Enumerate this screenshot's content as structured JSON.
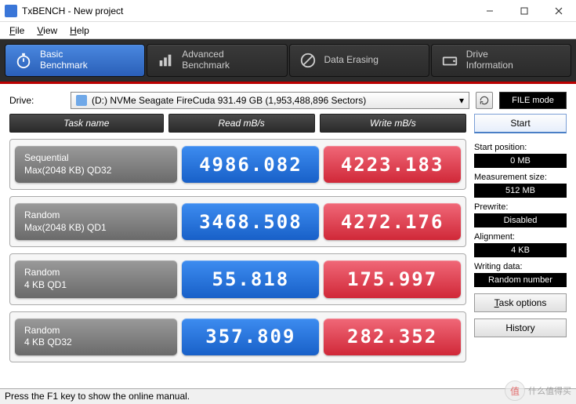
{
  "window": {
    "title": "TxBENCH - New project"
  },
  "menu": {
    "file": "File",
    "view": "View",
    "help": "Help"
  },
  "toolbar": {
    "basic": {
      "line1": "Basic",
      "line2": "Benchmark"
    },
    "advanced": {
      "line1": "Advanced",
      "line2": "Benchmark"
    },
    "erase": {
      "line1": "Data Erasing"
    },
    "drive": {
      "line1": "Drive",
      "line2": "Information"
    }
  },
  "drive": {
    "label": "Drive:",
    "value": "(D:) NVMe Seagate FireCuda  931.49 GB (1,953,488,896 Sectors)"
  },
  "filemode": "FILE mode",
  "headers": {
    "task": "Task name",
    "read": "Read mB/s",
    "write": "Write mB/s"
  },
  "rows": [
    {
      "name1": "Sequential",
      "name2": "Max(2048 KB) QD32",
      "read": "4986.082",
      "write": "4223.183"
    },
    {
      "name1": "Random",
      "name2": "Max(2048 KB) QD1",
      "read": "3468.508",
      "write": "4272.176"
    },
    {
      "name1": "Random",
      "name2": "4 KB QD1",
      "read": "55.818",
      "write": "175.997"
    },
    {
      "name1": "Random",
      "name2": "4 KB QD32",
      "read": "357.809",
      "write": "282.352"
    }
  ],
  "side": {
    "start": "Start",
    "startpos_label": "Start position:",
    "startpos_value": "0 MB",
    "meassize_label": "Measurement size:",
    "meassize_value": "512 MB",
    "prewrite_label": "Prewrite:",
    "prewrite_value": "Disabled",
    "align_label": "Alignment:",
    "align_value": "4 KB",
    "wdata_label": "Writing data:",
    "wdata_value": "Random number",
    "taskopt": "Task options",
    "history": "History"
  },
  "status": "Press the F1 key to show the online manual.",
  "watermark": "什么值得买"
}
